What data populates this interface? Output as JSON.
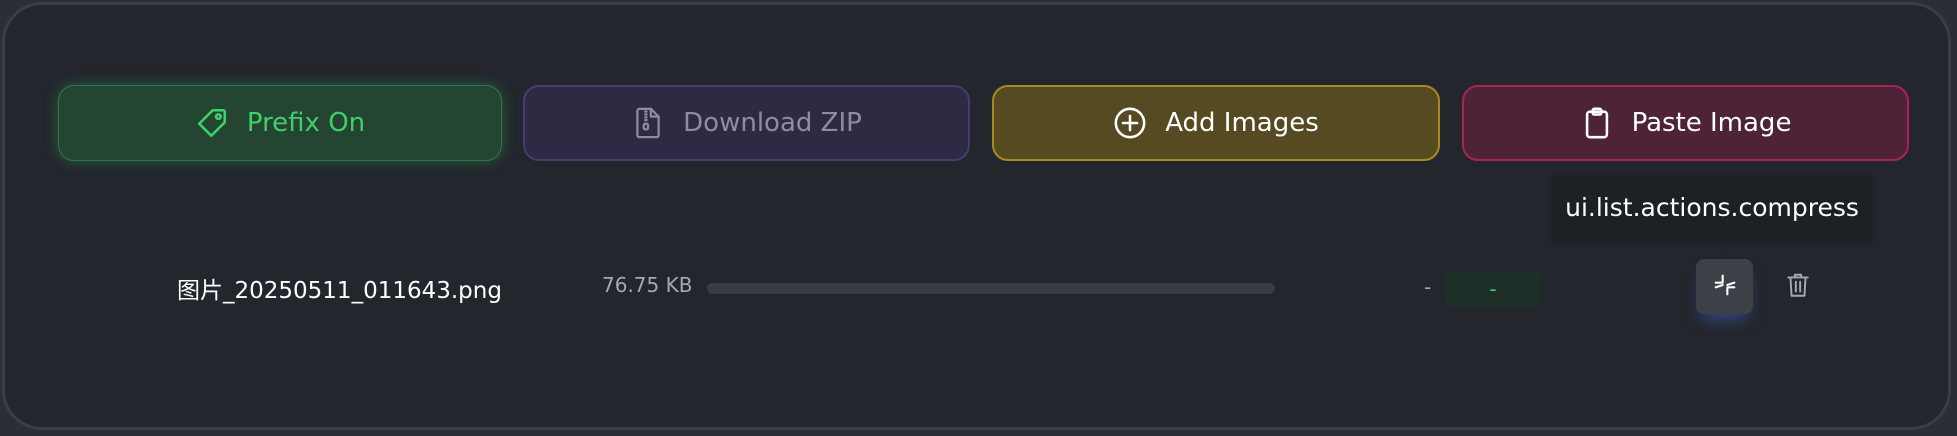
{
  "toolbar": {
    "prefix_button": {
      "label": "Prefix On",
      "icon": "tag-icon",
      "color": "#3fd06a"
    },
    "download_zip_button": {
      "label": "Download ZIP",
      "icon": "zip-file-icon",
      "color": "#8f8d9c"
    },
    "add_images_button": {
      "label": "Add Images",
      "icon": "plus-circle-icon",
      "color": "#a88a1e"
    },
    "paste_image_button": {
      "label": "Paste Image",
      "icon": "clipboard-icon",
      "color": "#a72453"
    }
  },
  "tooltip": {
    "text": "ui.list.actions.compress"
  },
  "file_list": [
    {
      "name": "图片_20250511_011643.png",
      "original_size": "76.75 KB",
      "progress_percent": 0,
      "original_dash": "-",
      "result": "-",
      "actions": [
        {
          "icon": "compress-icon"
        },
        {
          "icon": "trash-icon"
        }
      ]
    }
  ]
}
